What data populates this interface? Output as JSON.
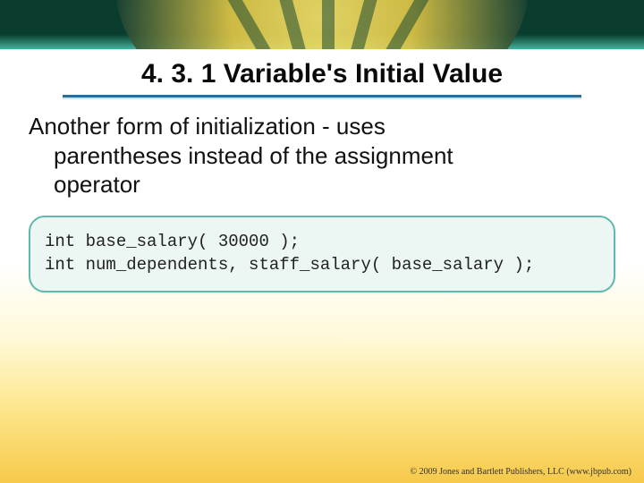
{
  "title": "4. 3. 1 Variable's Initial Value",
  "paragraph": {
    "line1": "Another form of initialization - uses",
    "line2": "parentheses instead of the assignment",
    "line3": "operator"
  },
  "code": {
    "line1": "int base_salary( 30000 );",
    "line2": "int num_dependents, staff_salary( base_salary );"
  },
  "footer": "© 2009 Jones and Bartlett Publishers, LLC (www.jbpub.com)"
}
